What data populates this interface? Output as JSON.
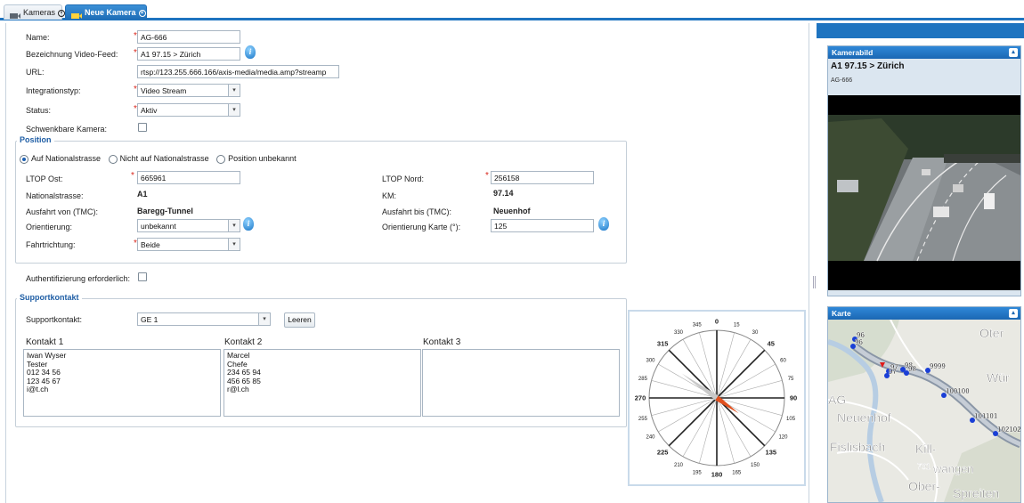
{
  "tabs": [
    {
      "label": "Kameras",
      "active": false
    },
    {
      "label": "Neue Kamera",
      "active": true
    }
  ],
  "form": {
    "name_label": "Name:",
    "name_value": "AG-666",
    "feed_label": "Bezeichnung Video-Feed:",
    "feed_value": "A1 97.15 > Zürich",
    "url_label": "URL:",
    "url_value": "rtsp://123.255.666.166/axis-media/media.amp?streamp",
    "integration_label": "Integrationstyp:",
    "integration_value": "Video Stream",
    "status_label": "Status:",
    "status_value": "Aktiv",
    "schwenk_label": "Schwenkbare Kamera:",
    "required_mark": "*"
  },
  "position": {
    "legend": "Position",
    "radio_options": [
      "Auf Nationalstrasse",
      "Nicht auf Nationalstrasse",
      "Position unbekannt"
    ],
    "selected_radio": 0,
    "ltop_ost_label": "LTOP Ost:",
    "ltop_ost_value": "665961",
    "ltop_nord_label": "LTOP Nord:",
    "ltop_nord_value": "256158",
    "nationalstrasse_label": "Nationalstrasse:",
    "nationalstrasse_value": "A1",
    "km_label": "KM:",
    "km_value": "97.14",
    "ausfahrt_von_label": "Ausfahrt von (TMC):",
    "ausfahrt_von_value": "Baregg-Tunnel",
    "ausfahrt_bis_label": "Ausfahrt bis (TMC):",
    "ausfahrt_bis_value": "Neuenhof",
    "orientierung_label": "Orientierung:",
    "orientierung_value": "unbekannt",
    "orientierung_karte_label": "Orientierung Karte (°):",
    "orientierung_karte_value": "125",
    "fahrtrichtung_label": "Fahrtrichtung:",
    "fahrtrichtung_value": "Beide"
  },
  "auth": {
    "label": "Authentifizierung erforderlich:"
  },
  "support": {
    "legend": "Supportkontakt",
    "label": "Supportkontakt:",
    "value": "GE 1",
    "clear_button": "Leeren",
    "kontakt1_label": "Kontakt 1",
    "kontakt1_lines": "Iwan Wyser\nTester\n012 34 56\n123 45 67\ni@t.ch",
    "kontakt2_label": "Kontakt 2",
    "kontakt2_lines": "Marcel\nChefe\n234 65 94\n456 65 85\nr@l.ch",
    "kontakt3_label": "Kontakt 3",
    "kontakt3_lines": ""
  },
  "compass": {
    "heading_deg": 125,
    "labels": [
      "0",
      "15",
      "30",
      "45",
      "60",
      "75",
      "90",
      "105",
      "120",
      "135",
      "150",
      "165",
      "180",
      "195",
      "210",
      "225",
      "240",
      "255",
      "270",
      "285",
      "300",
      "315",
      "330",
      "345"
    ],
    "bold_labels": [
      "0",
      "45",
      "90",
      "135",
      "180",
      "225",
      "270",
      "315"
    ]
  },
  "camera_panel": {
    "title": "Kamerabild",
    "caption": "A1 97.15 > Zürich",
    "camera_name": "AG-666"
  },
  "map_panel": {
    "title": "Karte",
    "place_labels": [
      "Neuenhof",
      "Fislisbach",
      "Kill-",
      "wangen",
      "Ober-",
      "Spreiten",
      "AG",
      "Wür",
      "Oter",
      "701"
    ],
    "marker_labels": [
      "96",
      "96",
      "97",
      "97",
      "98",
      "98",
      "9999",
      "100100",
      "101101",
      "102102"
    ]
  },
  "colors": {
    "accent": "#1e74c0",
    "required": "#d9261c",
    "legend": "#1f5ea5",
    "needle": "#e0501e"
  }
}
